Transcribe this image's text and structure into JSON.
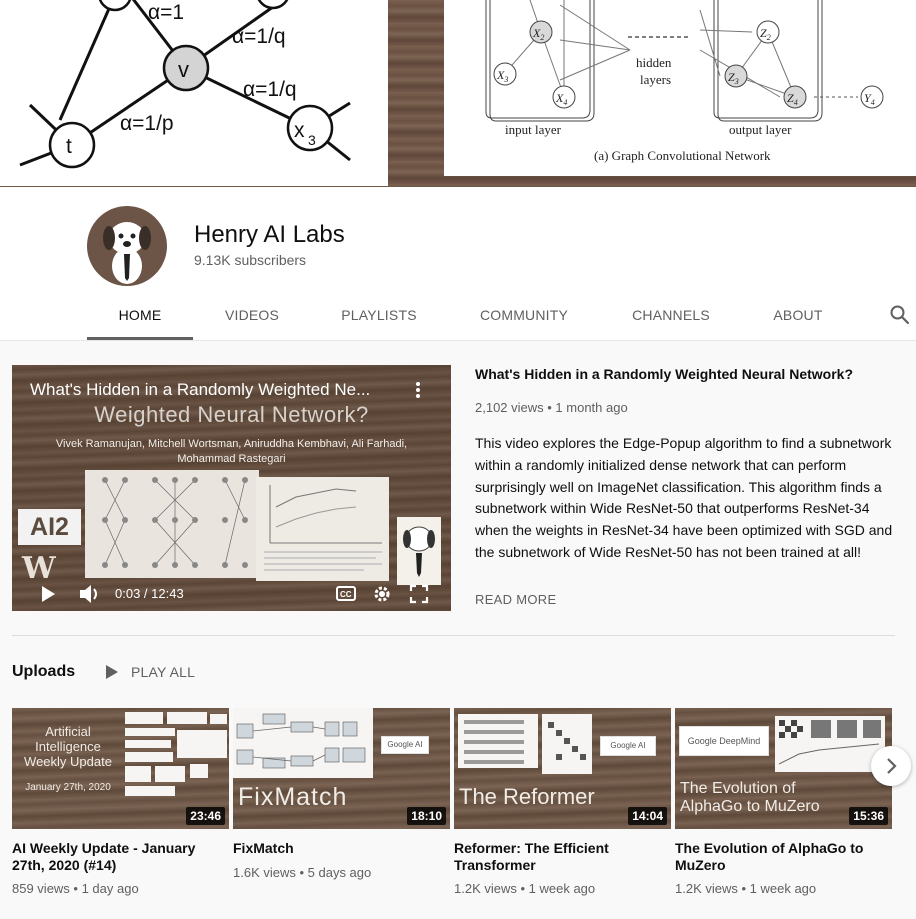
{
  "banner": {
    "left_graph": {
      "alpha_1": "α=1",
      "alpha_1q_top": "α=1/q",
      "alpha_1q_mid": "α=1/q",
      "alpha_1p": "α=1/p",
      "node_v": "v",
      "node_t": "t",
      "node_x3": "x",
      "node_x3_sub": "3"
    },
    "right_graph": {
      "hidden_label_1": "hidden",
      "hidden_label_2": "layers",
      "input_label": "input layer",
      "output_label": "output layer",
      "caption": "(a) Graph Convolutional Network"
    }
  },
  "channel": {
    "name": "Henry AI Labs",
    "subscribers": "9.13K subscribers"
  },
  "tabs": [
    "HOME",
    "VIDEOS",
    "PLAYLISTS",
    "COMMUNITY",
    "CHANNELS",
    "ABOUT"
  ],
  "featured": {
    "player_title": "What's Hidden in a Randomly Weighted Ne...",
    "player_bigtitle": "Weighted Neural Network?",
    "player_authors_1": "Vivek Ramanujan, Mitchell Wortsman, Aniruddha Kembhavi, Ali Farhadi,",
    "player_authors_2": "Mohammad Rastegari",
    "player_logo_ai2": "AI2",
    "player_logo_w": "W",
    "time": "0:03 / 12:43",
    "title": "What's Hidden in a Randomly Weighted Neural Network?",
    "meta": "2,102 views • 1 month ago",
    "description": "This video explores the Edge-Popup algorithm to find a subnetwork within a randomly initialized dense network that can perform surprisingly well on ImageNet classification. This algorithm finds a subnetwork within Wide ResNet-50 that outperforms ResNet-34 when the weights in ResNet-34 have been optimized with SGD and the subnetwork of Wide ResNet-50 has not been trained at all!",
    "read_more": "READ MORE"
  },
  "uploads": {
    "title": "Uploads",
    "play_all": "PLAY ALL",
    "items": [
      {
        "thumb_text": "Artificial\nIntelligence\nWeekly Update",
        "thumb_date": "January 27th, 2020",
        "duration": "23:46",
        "title": "AI Weekly Update - January 27th, 2020 (#14)",
        "meta": "859 views • 1 day ago"
      },
      {
        "thumb_text": "FixMatch",
        "badge": "Google AI",
        "duration": "18:10",
        "title": "FixMatch",
        "meta": "1.6K views • 5 days ago"
      },
      {
        "thumb_text": "The Reformer",
        "badge": "Google AI",
        "duration": "14:04",
        "title": "Reformer: The Efficient Transformer",
        "meta": "1.2K views • 1 week ago"
      },
      {
        "thumb_text": "The Evolution of\nAlphaGo to MuZero",
        "badge": "Google DeepMind",
        "duration": "15:36",
        "title": "The Evolution of AlphaGo to MuZero",
        "meta": "1.2K views • 1 week ago"
      }
    ]
  },
  "colors": {
    "accent_text": "#0f0f0f",
    "secondary_text": "#606060",
    "banner_wood": "#6e5646"
  }
}
